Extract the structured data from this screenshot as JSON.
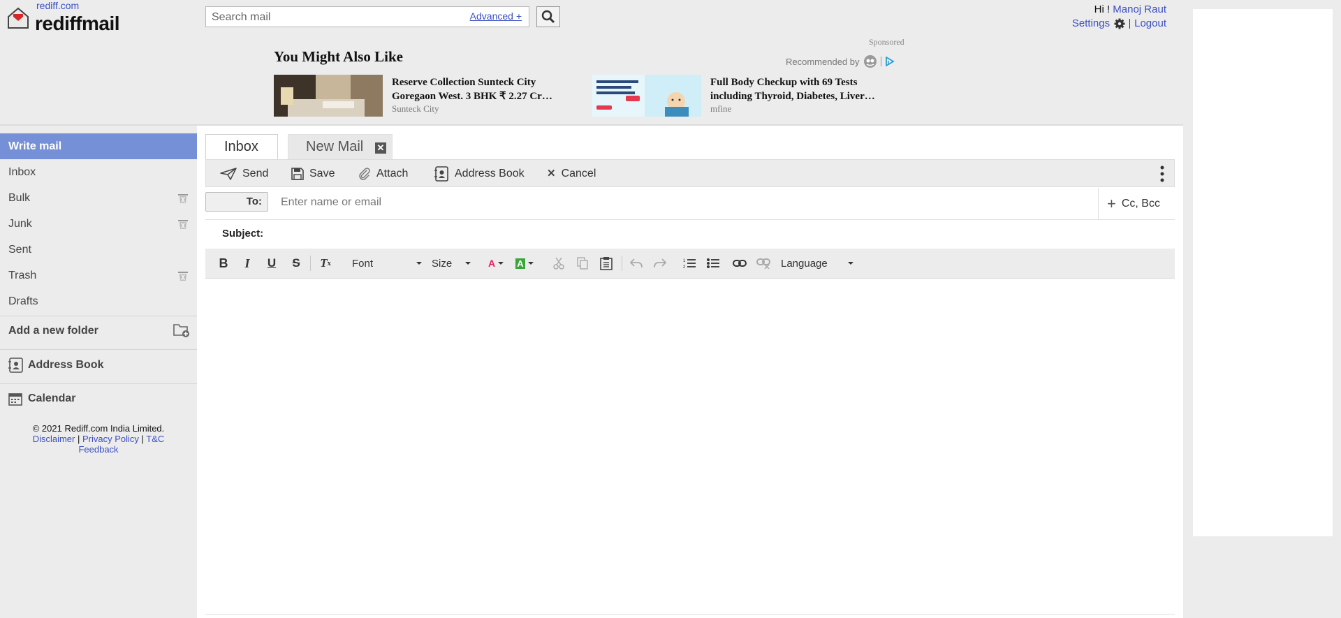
{
  "header": {
    "site_link": "rediff.com",
    "brand": "rediffmail",
    "search": {
      "placeholder": "Search mail",
      "advanced_label": "Advanced +"
    },
    "greeting_prefix": "Hi !",
    "user_name": "Manoj Raut",
    "settings_label": "Settings",
    "logout_label": "Logout"
  },
  "ads": {
    "sponsored": "Sponsored",
    "recommended_by": "Recommended by",
    "heading": "You Might Also Like",
    "items": [
      {
        "title": "Reserve Collection Sunteck City Goregaon West. 3 BHK ₹ 2.27 Cr…",
        "source": "Sunteck City"
      },
      {
        "title": "Full Body Checkup with 69 Tests including Thyroid, Diabetes, Liver…",
        "source": "mfine"
      }
    ]
  },
  "sidebar": {
    "items": [
      {
        "label": "Write mail"
      },
      {
        "label": "Inbox"
      },
      {
        "label": "Bulk"
      },
      {
        "label": "Junk"
      },
      {
        "label": "Sent"
      },
      {
        "label": "Trash"
      },
      {
        "label": "Drafts"
      }
    ],
    "add_folder": "Add a new folder",
    "address_book": "Address Book",
    "calendar": "Calendar",
    "footer": {
      "copyright": "© 2021 Rediff.com India Limited.",
      "disclaimer": "Disclaimer",
      "privacy": "Privacy Policy",
      "tc": "T&C",
      "feedback": "Feedback"
    }
  },
  "compose": {
    "tabs": [
      {
        "label": "Inbox"
      },
      {
        "label": "New Mail"
      }
    ],
    "toolbar": {
      "send": "Send",
      "save": "Save",
      "attach": "Attach",
      "address_book": "Address Book",
      "cancel": "Cancel"
    },
    "to_label": "To:",
    "to_placeholder": "Enter name or email",
    "cc_bcc": "Cc, Bcc",
    "subject_label": "Subject:",
    "editor": {
      "font_label": "Font",
      "size_label": "Size",
      "language_label": "Language"
    }
  }
}
